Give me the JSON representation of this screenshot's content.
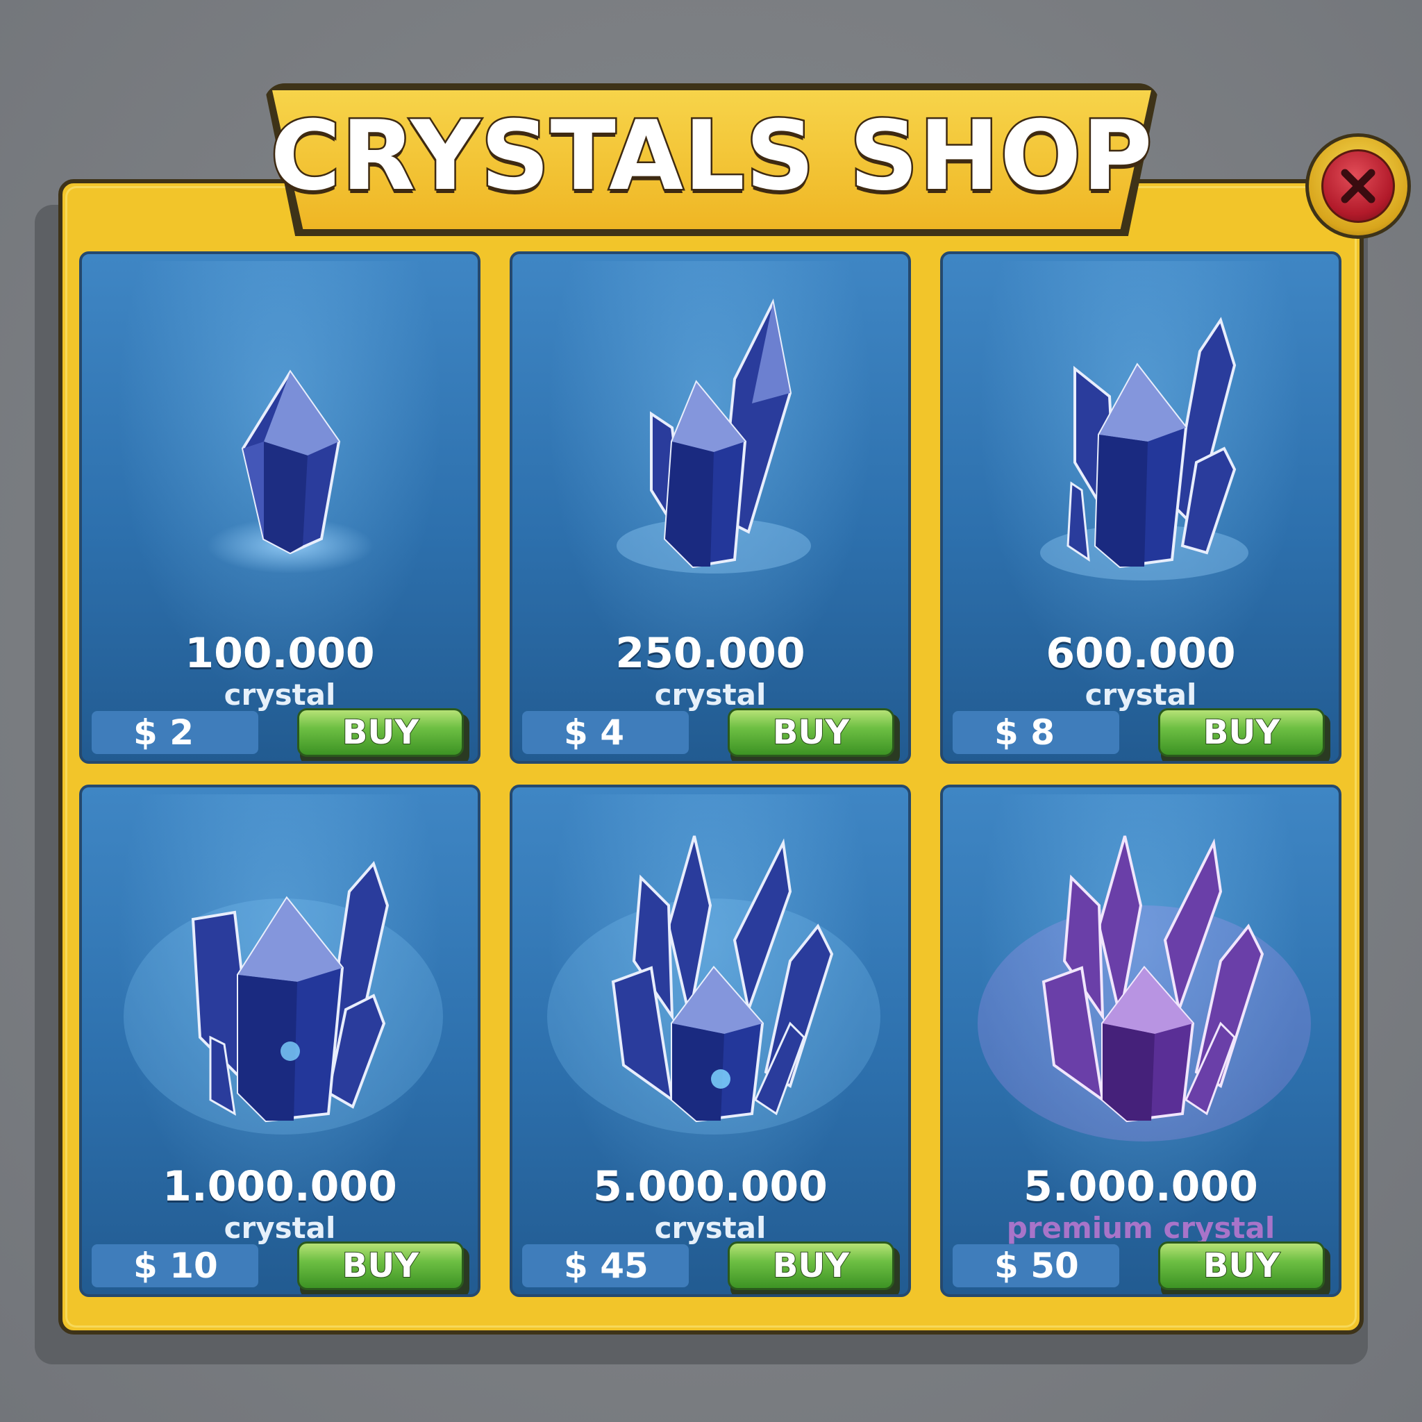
{
  "shop": {
    "title": "CRYSTALS SHOP",
    "buy_label": "BUY"
  },
  "items": [
    {
      "amount": "100.000",
      "unit": "crystal",
      "currency": "$",
      "price": "2",
      "variant": "blue"
    },
    {
      "amount": "250.000",
      "unit": "crystal",
      "currency": "$",
      "price": "4",
      "variant": "blue"
    },
    {
      "amount": "600.000",
      "unit": "crystal",
      "currency": "$",
      "price": "8",
      "variant": "blue"
    },
    {
      "amount": "1.000.000",
      "unit": "crystal",
      "currency": "$",
      "price": "10",
      "variant": "blue"
    },
    {
      "amount": "5.000.000",
      "unit": "crystal",
      "currency": "$",
      "price": "45",
      "variant": "blue"
    },
    {
      "amount": "5.000.000",
      "unit": "premium crystal",
      "currency": "$",
      "price": "50",
      "variant": "purple"
    }
  ],
  "colors": {
    "frame": "#f2c52a",
    "card_blue": "#2d70ad",
    "buy_green": "#6dbf43",
    "close_red": "#b21a2a",
    "premium_text": "#a874c9"
  },
  "icons": {
    "close": "close-icon",
    "item": "crystal-icon"
  }
}
